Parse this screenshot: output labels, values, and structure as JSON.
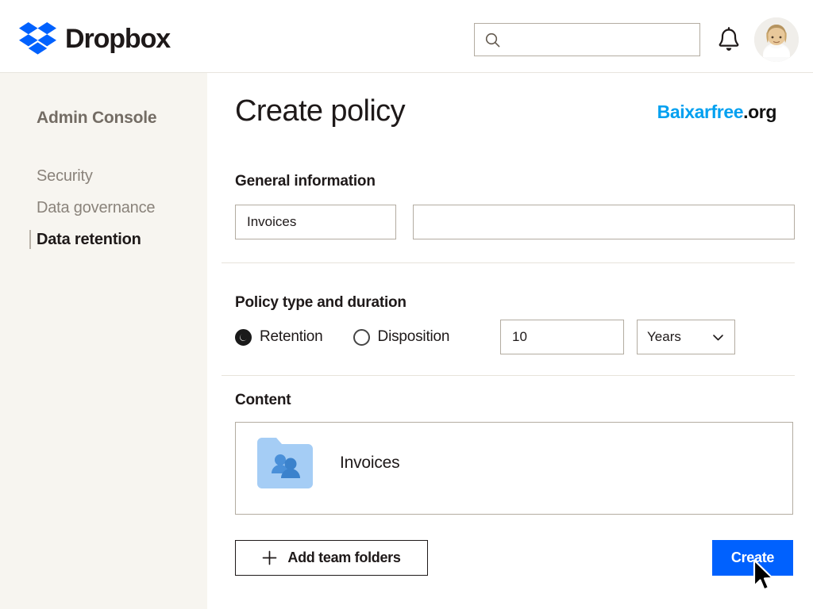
{
  "header": {
    "brand_name": "Dropbox",
    "brand_logo_icon": "dropbox-logo-icon",
    "search": {
      "value": "",
      "placeholder": "",
      "icon": "search-icon"
    },
    "notifications_icon": "bell-icon",
    "avatar_alt": "user-avatar"
  },
  "sidebar": {
    "title": "Admin Console",
    "items": [
      {
        "label": "Security",
        "active": false
      },
      {
        "label": "Data governance",
        "active": false
      },
      {
        "label": "Data retention",
        "active": true
      }
    ]
  },
  "main": {
    "page_title": "Create policy",
    "watermark": {
      "part1": "Baixarfree",
      "part2": ".org"
    },
    "sections": {
      "general": {
        "heading": "General information",
        "name_value": "Invoices",
        "name_placeholder": "",
        "description_value": "",
        "description_placeholder": ""
      },
      "policy": {
        "heading": "Policy type and duration",
        "options": [
          {
            "label": "Retention",
            "selected": true
          },
          {
            "label": "Disposition",
            "selected": false
          }
        ],
        "duration_value": "10",
        "unit_value": "Years",
        "unit_icon": "chevron-down-icon"
      },
      "content": {
        "heading": "Content",
        "folders": [
          {
            "name": "Invoices",
            "icon": "team-folder-icon"
          }
        ]
      }
    },
    "actions": {
      "add_folders_label": "Add team folders",
      "add_folders_icon": "plus-icon",
      "create_label": "Create"
    }
  },
  "colors": {
    "dropbox_blue": "#0061fe",
    "sidebar_bg": "#f7f5f0",
    "watermark_blue": "#00a0f0",
    "folder_blue": "#a5cdf5",
    "border": "#b3aca1"
  },
  "cursor": {
    "icon": "mouse-pointer-icon"
  }
}
